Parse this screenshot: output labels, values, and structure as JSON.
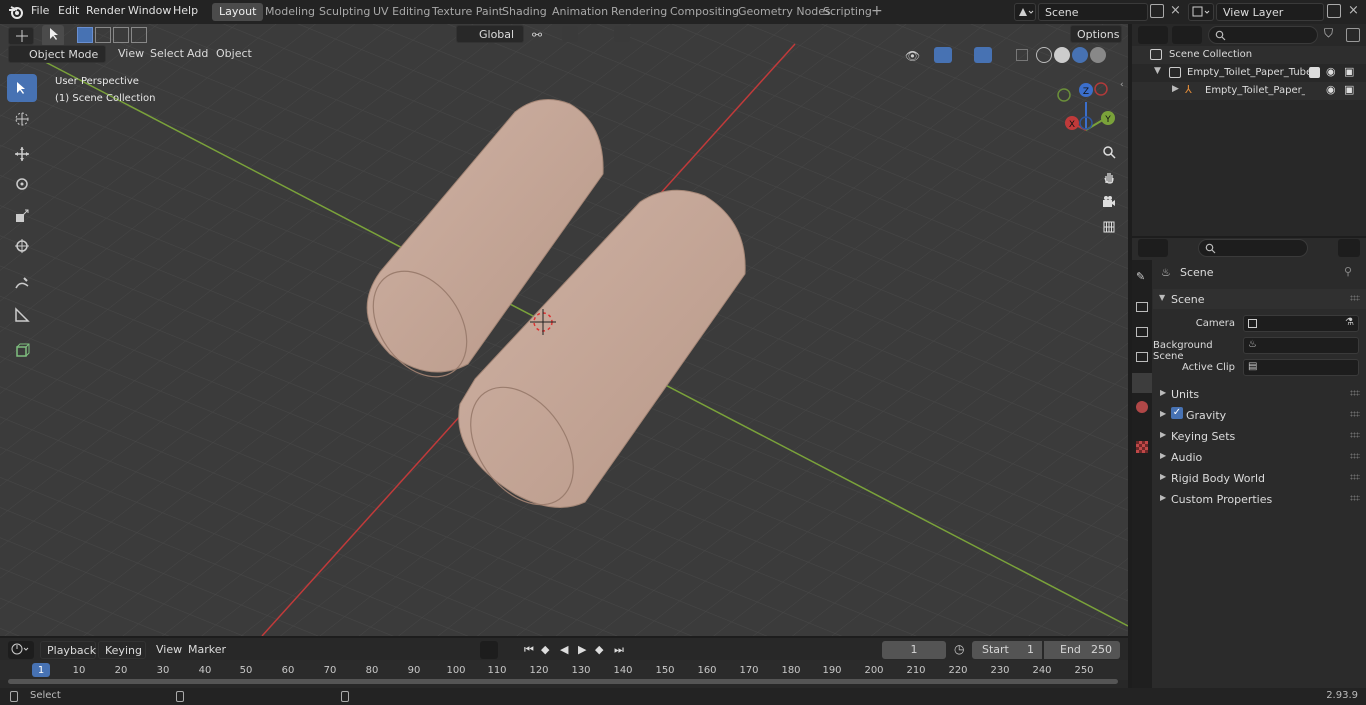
{
  "menu": [
    "File",
    "Edit",
    "Render",
    "Window",
    "Help"
  ],
  "workspaces": [
    "Layout",
    "Modeling",
    "Sculpting",
    "UV Editing",
    "Texture Paint",
    "Shading",
    "Animation",
    "Rendering",
    "Compositing",
    "Geometry Nodes",
    "Scripting"
  ],
  "active_workspace": "Layout",
  "scene_field": "Scene",
  "view_layer_field": "View Layer",
  "viewport": {
    "mode": "Object Mode",
    "menus": [
      "View",
      "Select",
      "Add",
      "Object"
    ],
    "transform_orientation": "Global",
    "options_label": "Options",
    "overlay_title": "User Perspective",
    "overlay_collection": "(1) Scene Collection"
  },
  "gizmo": {
    "z": "Z",
    "y": "Y",
    "x": "X"
  },
  "outliner": {
    "root": "Scene Collection",
    "collection": "Empty_Toilet_Paper_Tubes",
    "object": "Empty_Toilet_Paper_Tube"
  },
  "properties": {
    "context": "Scene",
    "panel": "Scene",
    "camera_label": "Camera",
    "background_scene_label": "Background Scene",
    "active_clip_label": "Active Clip",
    "sections": [
      "Units",
      "Gravity",
      "Keying Sets",
      "Audio",
      "Rigid Body World",
      "Custom Properties"
    ]
  },
  "timeline": {
    "menus": [
      "Playback",
      "Keying",
      "View",
      "Marker"
    ],
    "current_frame": "1",
    "start_label": "Start",
    "start_value": "1",
    "end_label": "End",
    "end_value": "250",
    "ticks": [
      "1",
      "10",
      "20",
      "30",
      "40",
      "50",
      "60",
      "70",
      "80",
      "90",
      "100",
      "110",
      "120",
      "130",
      "140",
      "150",
      "160",
      "170",
      "180",
      "190",
      "200",
      "210",
      "220",
      "230",
      "240",
      "250"
    ]
  },
  "status": {
    "left": "Select",
    "version": "2.93.9"
  },
  "colors": {
    "accent": "#4772b3",
    "tube": "#c2a395",
    "x_axis": "#c03a3a",
    "y_axis": "#7aa23a"
  }
}
